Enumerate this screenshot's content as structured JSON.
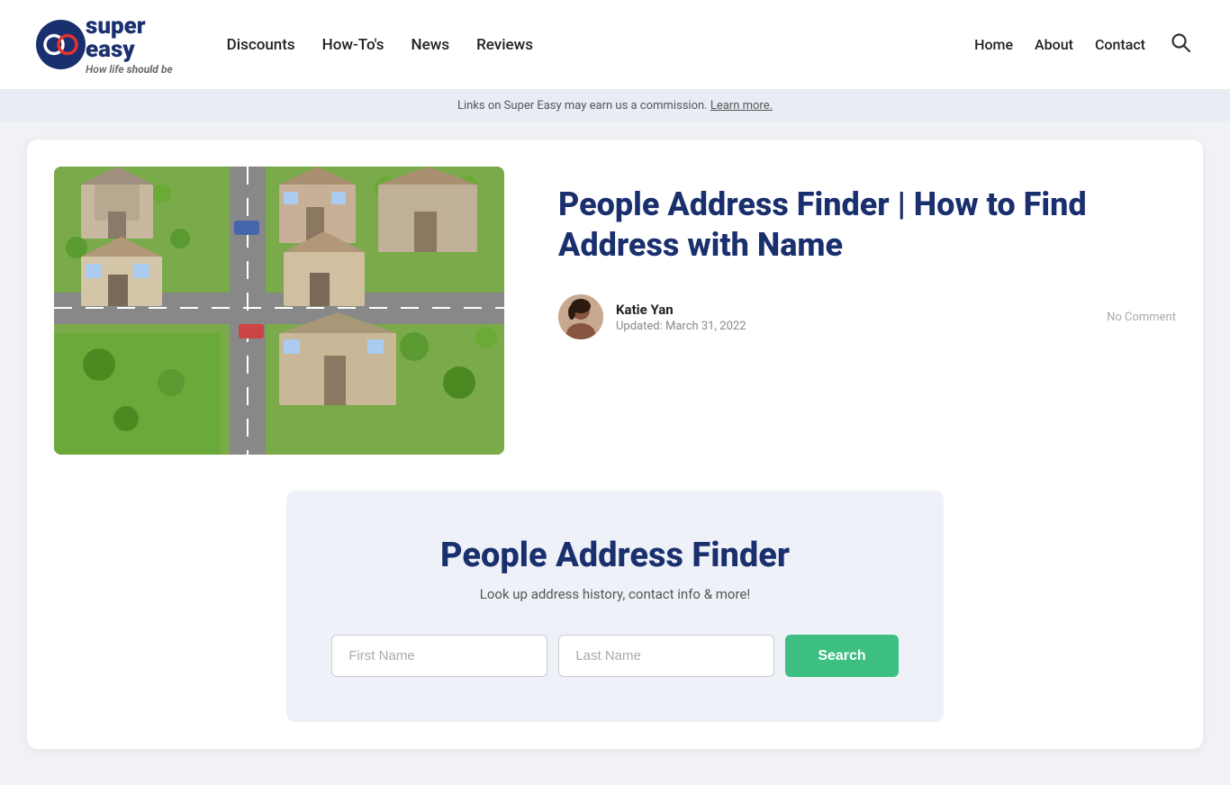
{
  "header": {
    "logo": {
      "super": "super",
      "easy": "easy",
      "tagline_prefix": "How life ",
      "tagline_highlight": "should",
      "tagline_suffix": " be"
    },
    "nav": {
      "items": [
        {
          "label": "Discounts",
          "href": "#"
        },
        {
          "label": "How-To's",
          "href": "#"
        },
        {
          "label": "News",
          "href": "#"
        },
        {
          "label": "Reviews",
          "href": "#"
        }
      ]
    },
    "right_nav": {
      "items": [
        {
          "label": "Home",
          "href": "#"
        },
        {
          "label": "About",
          "href": "#"
        },
        {
          "label": "Contact",
          "href": "#"
        }
      ]
    }
  },
  "disclaimer": {
    "text": "Links on Super Easy may earn us a commission. Learn more.",
    "link_text": "Learn more."
  },
  "article": {
    "title": "People Address Finder | How to Find Address with Name",
    "author": {
      "name": "Katie Yan",
      "updated_label": "Updated: March 31, 2022"
    },
    "no_comment": "No Comment"
  },
  "finder_widget": {
    "title": "People Address Finder",
    "subtitle": "Look up address history, contact info & more!",
    "first_name_placeholder": "First Name",
    "last_name_placeholder": "Last Name",
    "search_button": "Search"
  }
}
